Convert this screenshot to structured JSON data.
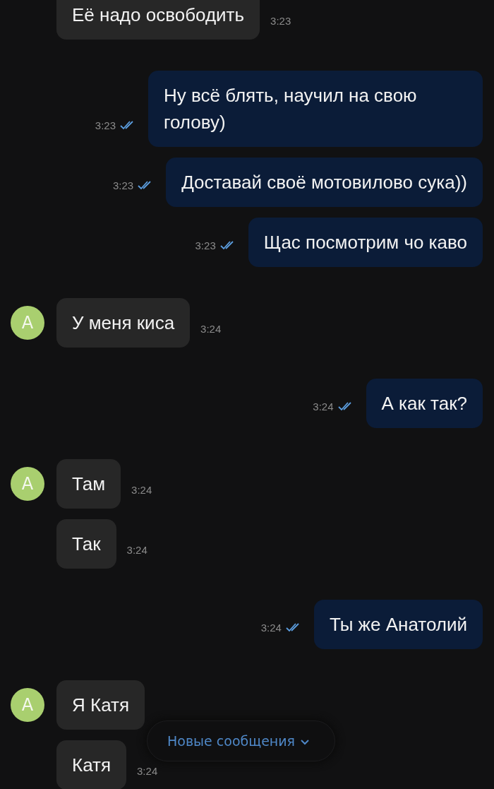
{
  "messages": [
    {
      "kind": "incoming",
      "text": "Её надо освободить",
      "time": "3:23"
    },
    {
      "kind": "outgoing",
      "text": "Ну всё блять, научил на свою голову)",
      "time": "3:23",
      "read": true
    },
    {
      "kind": "outgoing",
      "text": "Доставай своё мотовилово сука))",
      "time": "3:23",
      "read": true
    },
    {
      "kind": "outgoing",
      "text": "Щас посмотрим чо каво",
      "time": "3:23",
      "read": true
    },
    {
      "kind": "incoming",
      "avatar": "А",
      "text": "У меня киса",
      "time": "3:24"
    },
    {
      "kind": "outgoing",
      "text": "А как так?",
      "time": "3:24",
      "read": true
    },
    {
      "kind": "incoming",
      "avatar": "А",
      "text": "Там",
      "time": "3:24"
    },
    {
      "kind": "incoming",
      "text": "Так",
      "time": "3:24"
    },
    {
      "kind": "outgoing",
      "text": "Ты же Анатолий",
      "time": "3:24",
      "read": true
    },
    {
      "kind": "incoming",
      "avatar": "А",
      "text": "Я Катя"
    },
    {
      "kind": "incoming",
      "text": "Катя",
      "time": "3:24"
    }
  ],
  "new_messages_button": {
    "label": "Новые сообщения"
  }
}
